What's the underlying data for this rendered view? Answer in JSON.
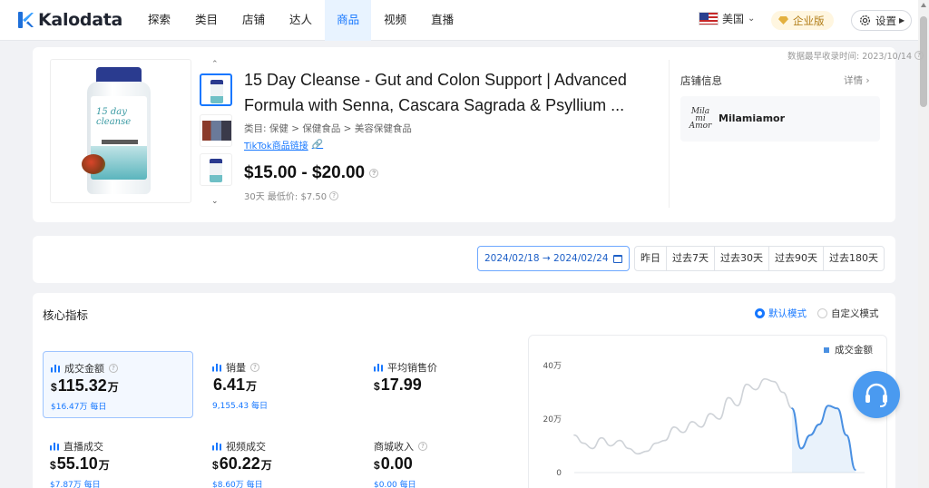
{
  "header": {
    "logo": "Kalodata",
    "nav": [
      "探索",
      "类目",
      "店铺",
      "达人",
      "商品",
      "视频",
      "直播"
    ],
    "active_nav": "商品",
    "region": "美国",
    "enterprise": "企业版",
    "settings": "设置"
  },
  "product": {
    "first_seen": "数据最早收录时间: 2023/10/14",
    "title": "15 Day Cleanse - Gut and Colon Support | Advanced Formula with Senna, Cascara Sagrada & Psyllium ...",
    "category": "类目: 保健 > 保健食品 > 美容保健食品",
    "tiktok_link": "TikTok商品链接",
    "price": "$15.00 - $20.00",
    "lowest_price": "30天 最低价: $7.50",
    "bottle_text": "15 day cleanse"
  },
  "store": {
    "title": "店铺信息",
    "detail": "详情",
    "name": "Milamiamor",
    "logo_text": "Mila mi Amor"
  },
  "date_filter": {
    "range": "2024/02/18 → 2024/02/24",
    "quick": [
      "昨日",
      "过去7天",
      "过去30天",
      "过去90天",
      "过去180天"
    ]
  },
  "metrics": {
    "heading": "核心指标",
    "mode_default": "默认模式",
    "mode_custom": "自定义模式",
    "items": [
      {
        "label": "成交金额",
        "currency": "$",
        "value": "115.32",
        "unit": "万",
        "sub": "$16.47万 每日",
        "selected": true
      },
      {
        "label": "销量",
        "currency": "",
        "value": "6.41",
        "unit": "万",
        "sub": "9,155.43 每日"
      },
      {
        "label": "平均销售价",
        "currency": "$",
        "value": "17.99",
        "unit": "",
        "sub": ""
      },
      {
        "label": "直播成交",
        "currency": "$",
        "value": "55.10",
        "unit": "万",
        "sub": "$7.87万 每日"
      },
      {
        "label": "视频成交",
        "currency": "$",
        "value": "60.22",
        "unit": "万",
        "sub": "$8.60万 每日"
      },
      {
        "label": "商城收入",
        "currency": "$",
        "value": "0.00",
        "unit": "",
        "sub": "$0.00 每日"
      }
    ]
  },
  "chart_data": {
    "type": "line",
    "series": [
      {
        "name": "成交金额",
        "values": [
          14,
          11,
          9,
          13,
          10,
          12,
          9,
          7,
          8,
          11,
          12,
          17,
          15,
          19,
          17,
          22,
          20,
          28,
          25,
          33,
          31,
          35,
          34,
          30,
          24,
          9,
          14,
          18,
          25,
          24,
          14,
          1
        ]
      }
    ],
    "y_ticks": [
      "40万",
      "20万",
      "0"
    ],
    "ylim": [
      0,
      40
    ],
    "accent": "#4a90e2"
  }
}
